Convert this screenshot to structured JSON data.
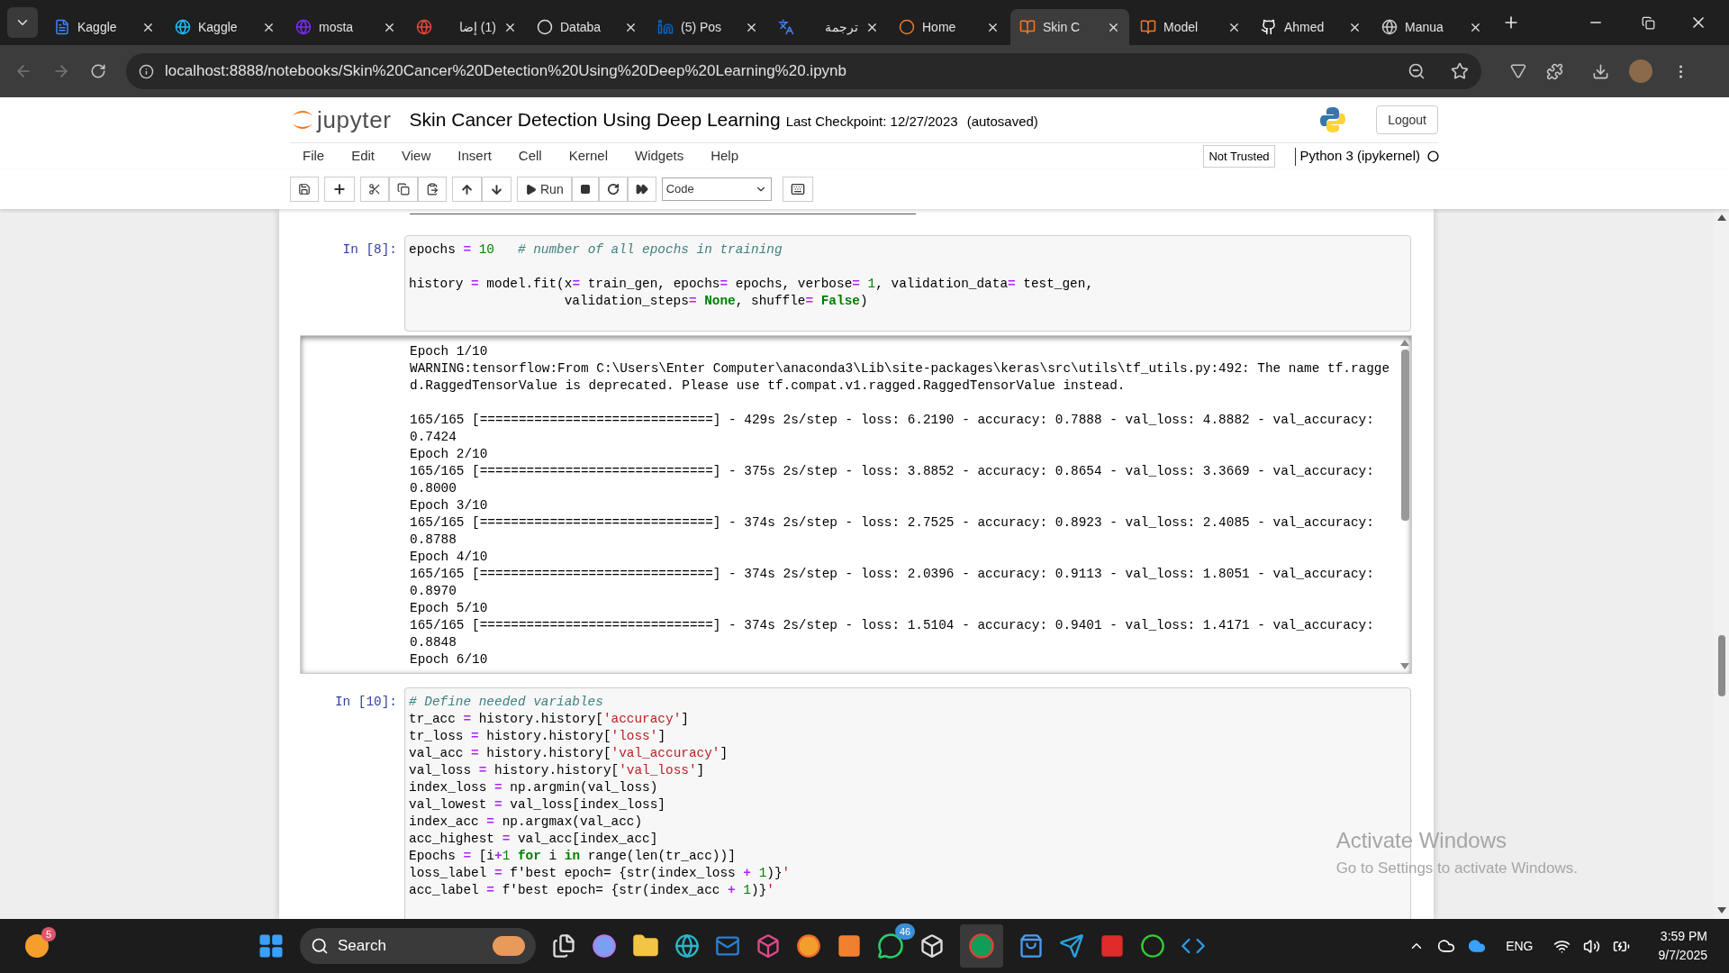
{
  "browser": {
    "tabs": [
      {
        "title": "Kaggle",
        "selected": false
      },
      {
        "title": "Kaggle",
        "selected": false
      },
      {
        "title": "mosta",
        "selected": false
      },
      {
        "title": "(1) إضا",
        "selected": false
      },
      {
        "title": "Databa",
        "selected": false
      },
      {
        "title": "(5) Pos",
        "selected": false
      },
      {
        "title": "ترجمة",
        "selected": false
      },
      {
        "title": "Home",
        "selected": false
      },
      {
        "title": "Skin C",
        "selected": true
      },
      {
        "title": "Model",
        "selected": false
      },
      {
        "title": "Ahmed",
        "selected": false
      },
      {
        "title": "Manua",
        "selected": false
      }
    ],
    "url": "localhost:8888/notebooks/Skin%20Cancer%20Detection%20Using%20Deep%20Learning%20.ipynb"
  },
  "jupyter": {
    "logo_text": "jupyter",
    "notebook_title": "Skin Cancer Detection Using Deep Learning",
    "checkpoint": "Last Checkpoint: 12/27/2023",
    "autosave": "(autosaved)",
    "logout": "Logout",
    "menu": [
      "File",
      "Edit",
      "View",
      "Insert",
      "Cell",
      "Kernel",
      "Widgets",
      "Help"
    ],
    "trust": "Not Trusted",
    "kernel": "Python 3 (ipykernel)",
    "run_label": "Run",
    "cell_type": "Code"
  },
  "cells": [
    {
      "prompt": "In [8]:",
      "paragraphs": [
        [
          {
            "tokens": [
              {
                "kind": "plain",
                "text": "epochs "
              },
              {
                "kind": "op",
                "text": "="
              },
              {
                "kind": "num",
                "text": " 10"
              },
              {
                "kind": "comment",
                "text": "   # number of all epochs in training"
              }
            ]
          }
        ],
        [
          {
            "tokens": [
              {
                "kind": "plain",
                "text": "history "
              },
              {
                "kind": "op",
                "text": "="
              },
              {
                "kind": "plain",
                "text": " model.fit(x"
              },
              {
                "kind": "op",
                "text": "="
              },
              {
                "kind": "plain",
                "text": " train_gen, epochs"
              },
              {
                "kind": "op",
                "text": "="
              },
              {
                "kind": "plain",
                "text": " epochs, verbose"
              },
              {
                "kind": "op",
                "text": "="
              },
              {
                "kind": "num",
                "text": " 1"
              },
              {
                "kind": "plain",
                "text": ", validation_data"
              },
              {
                "kind": "op",
                "text": "="
              },
              {
                "kind": "plain",
                "text": " test_gen,"
              }
            ]
          },
          {
            "tokens": [
              {
                "kind": "plain",
                "text": "                    validation_steps"
              },
              {
                "kind": "op",
                "text": "="
              },
              {
                "kind": "keyword",
                "text": " None"
              },
              {
                "kind": "plain",
                "text": ", shuffle"
              },
              {
                "kind": "op",
                "text": "="
              },
              {
                "kind": "keyword",
                "text": " False"
              },
              {
                "kind": "plain",
                "text": ")"
              }
            ]
          }
        ]
      ],
      "output": [
        [
          {
            "text": "Epoch 1/10"
          },
          {
            "text": "WARNING:tensorflow:From C:\\Users\\Enter Computer\\anaconda3\\Lib\\site-packages\\keras\\src\\utils\\tf_utils.py:492: The name tf.ragged.RaggedTensorValue is deprecated. Please use tf.compat.v1.ragged.RaggedTensorValue instead."
          }
        ],
        [
          {
            "text": "165/165 [==============================] - 429s 2s/step - loss: 6.2190 - accuracy: 0.7888 - val_loss: 4.8882 - val_accuracy: 0.7424"
          },
          {
            "text": "Epoch 2/10"
          },
          {
            "text": "165/165 [==============================] - 375s 2s/step - loss: 3.8852 - accuracy: 0.8654 - val_loss: 3.3669 - val_accuracy: 0.8000"
          },
          {
            "text": "Epoch 3/10"
          },
          {
            "text": "165/165 [==============================] - 374s 2s/step - loss: 2.7525 - accuracy: 0.8923 - val_loss: 2.4085 - val_accuracy: 0.8788"
          },
          {
            "text": "Epoch 4/10"
          },
          {
            "text": "165/165 [==============================] - 374s 2s/step - loss: 2.0396 - accuracy: 0.9113 - val_loss: 1.8051 - val_accuracy: 0.8970"
          },
          {
            "text": "Epoch 5/10"
          },
          {
            "text": "165/165 [==============================] - 374s 2s/step - loss: 1.5104 - accuracy: 0.9401 - val_loss: 1.4171 - val_accuracy: 0.8848"
          },
          {
            "text": "Epoch 6/10"
          }
        ]
      ]
    },
    {
      "prompt": "In [10]:",
      "paragraphs": [
        [
          {
            "tokens": [
              {
                "kind": "comment",
                "text": "# Define needed variables"
              }
            ]
          },
          {
            "tokens": [
              {
                "kind": "plain",
                "text": "tr_acc "
              },
              {
                "kind": "op",
                "text": "="
              },
              {
                "kind": "plain",
                "text": " history.history["
              },
              {
                "kind": "string",
                "text": "'accuracy'"
              },
              {
                "kind": "plain",
                "text": "]"
              }
            ]
          },
          {
            "tokens": [
              {
                "kind": "plain",
                "text": "tr_loss "
              },
              {
                "kind": "op",
                "text": "="
              },
              {
                "kind": "plain",
                "text": " history.history["
              },
              {
                "kind": "string",
                "text": "'loss'"
              },
              {
                "kind": "plain",
                "text": "]"
              }
            ]
          },
          {
            "tokens": [
              {
                "kind": "plain",
                "text": "val_acc "
              },
              {
                "kind": "op",
                "text": "="
              },
              {
                "kind": "plain",
                "text": " history.history["
              },
              {
                "kind": "string",
                "text": "'val_accuracy'"
              },
              {
                "kind": "plain",
                "text": "]"
              }
            ]
          },
          {
            "tokens": [
              {
                "kind": "plain",
                "text": "val_loss "
              },
              {
                "kind": "op",
                "text": "="
              },
              {
                "kind": "plain",
                "text": " history.history["
              },
              {
                "kind": "string",
                "text": "'val_loss'"
              },
              {
                "kind": "plain",
                "text": "]"
              }
            ]
          },
          {
            "tokens": [
              {
                "kind": "plain",
                "text": "index_loss "
              },
              {
                "kind": "op",
                "text": "="
              },
              {
                "kind": "plain",
                "text": " np.argmin(val_loss)"
              }
            ]
          },
          {
            "tokens": [
              {
                "kind": "plain",
                "text": "val_lowest "
              },
              {
                "kind": "op",
                "text": "="
              },
              {
                "kind": "plain",
                "text": " val_loss[index_loss]"
              }
            ]
          },
          {
            "tokens": [
              {
                "kind": "plain",
                "text": "index_acc "
              },
              {
                "kind": "op",
                "text": "="
              },
              {
                "kind": "plain",
                "text": " np.argmax(val_acc)"
              }
            ]
          },
          {
            "tokens": [
              {
                "kind": "plain",
                "text": "acc_highest "
              },
              {
                "kind": "op",
                "text": "="
              },
              {
                "kind": "plain",
                "text": " val_acc[index_acc]"
              }
            ]
          },
          {
            "tokens": [
              {
                "kind": "plain",
                "text": "Epochs "
              },
              {
                "kind": "op",
                "text": "="
              },
              {
                "kind": "plain",
                "text": " [i"
              },
              {
                "kind": "op",
                "text": "+"
              },
              {
                "kind": "num",
                "text": "1"
              },
              {
                "kind": "keyword",
                "text": " for"
              },
              {
                "kind": "plain",
                "text": " i"
              },
              {
                "kind": "keyword",
                "text": " in"
              },
              {
                "kind": "plain",
                "text": " range(len(tr_acc))]"
              }
            ]
          },
          {
            "tokens": [
              {
                "kind": "plain",
                "text": "loss_label "
              },
              {
                "kind": "op",
                "text": "="
              },
              {
                "kind": "plain",
                "text": " f'best epoch= {str(index_loss "
              },
              {
                "kind": "op",
                "text": "+"
              },
              {
                "kind": "num",
                "text": " 1"
              },
              {
                "kind": "plain",
                "text": ")}"
              },
              {
                "kind": "string",
                "text": "'"
              }
            ]
          },
          {
            "tokens": [
              {
                "kind": "plain",
                "text": "acc_label "
              },
              {
                "kind": "op",
                "text": "="
              },
              {
                "kind": "plain",
                "text": " f'best epoch= {str(index_acc "
              },
              {
                "kind": "op",
                "text": "+"
              },
              {
                "kind": "num",
                "text": " 1"
              },
              {
                "kind": "plain",
                "text": ")}"
              },
              {
                "kind": "string",
                "text": "'"
              }
            ]
          }
        ]
      ]
    }
  ],
  "activation": {
    "title": "Activate Windows",
    "hint": "Go to Settings to activate Windows."
  },
  "taskbar": {
    "notification_badge": "5",
    "search": "Search",
    "whatsapp_badge": "46",
    "language": "ENG",
    "time": "3:59 PM",
    "date": "9/7/2025"
  }
}
